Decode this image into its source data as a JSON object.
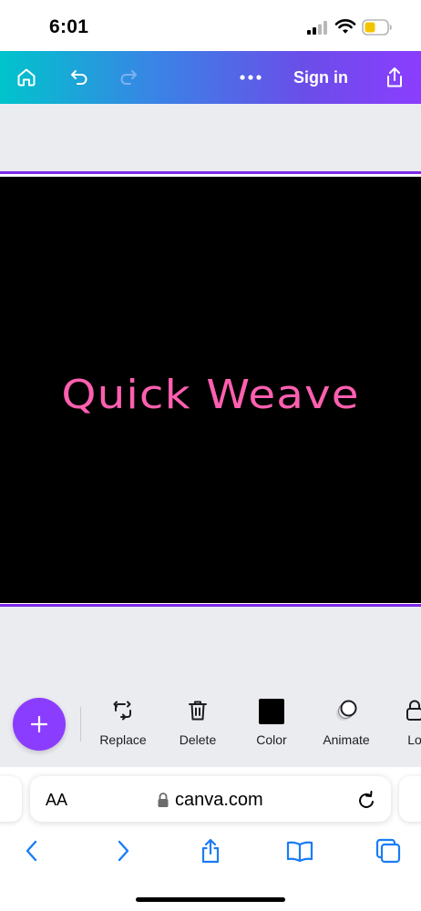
{
  "status_bar": {
    "time": "6:01"
  },
  "header": {
    "sign_in_label": "Sign in",
    "icons": [
      "home-icon",
      "undo-icon",
      "redo-icon",
      "more-icon",
      "share-icon"
    ]
  },
  "design": {
    "text": "Quick Weave",
    "text_color": "#ff5fb0",
    "background_color": "#000000"
  },
  "toolbar": {
    "tools": [
      {
        "label": "Replace",
        "icon": "replace-icon"
      },
      {
        "label": "Delete",
        "icon": "trash-icon"
      },
      {
        "label": "Color",
        "icon": "color-swatch-icon"
      },
      {
        "label": "Animate",
        "icon": "animate-icon"
      },
      {
        "label": "Lo",
        "icon": "lock-icon"
      }
    ]
  },
  "browser": {
    "text_size_label": "AA",
    "url": "canva.com"
  },
  "colors": {
    "accent": "#8b3dff",
    "frame": "#7d2ae8",
    "ios_blue": "#1a7cf5"
  }
}
